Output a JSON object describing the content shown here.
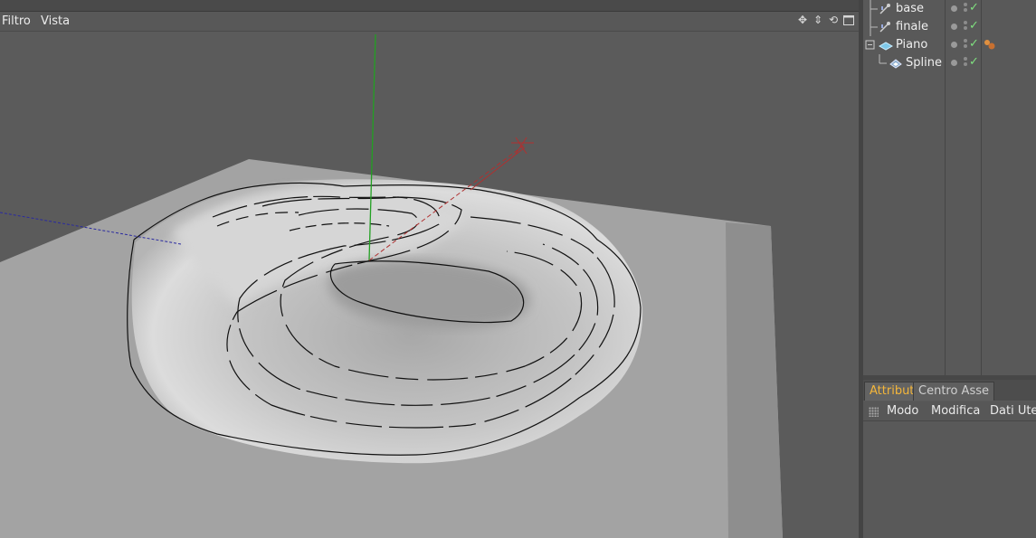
{
  "viewport": {
    "menus": [
      "Filtro",
      "Vista"
    ],
    "nav_icons": [
      "move-view-icon",
      "dolly-icon",
      "rotate-view-icon",
      "maximize-view-icon"
    ]
  },
  "object_manager": {
    "objects": [
      {
        "name": "base",
        "icon": "pose-morph-icon",
        "depth": 1,
        "visible": true,
        "enabled": true,
        "has_tag": false
      },
      {
        "name": "finale",
        "icon": "pose-morph-icon",
        "depth": 1,
        "visible": true,
        "enabled": true,
        "has_tag": false
      },
      {
        "name": "Piano",
        "icon": "plane-icon",
        "depth": 0,
        "visible": true,
        "enabled": true,
        "has_tag": true
      },
      {
        "name": "Spline",
        "icon": "spline-icon",
        "depth": 1,
        "visible": true,
        "enabled": true,
        "has_tag": false
      }
    ]
  },
  "attributes": {
    "tabs": [
      "Attributi",
      "Centro Asse"
    ],
    "active_tab": "Attributi",
    "menus": [
      "Modo",
      "Modifica",
      "Dati Uter"
    ]
  },
  "colors": {
    "background": "#5b5b5b",
    "active_tab_text": "#f4b63a",
    "check_green": "#7fe07f",
    "axis_y": "#22a022",
    "axis_x": "#b03030",
    "axis_z": "#2a2aa0"
  }
}
